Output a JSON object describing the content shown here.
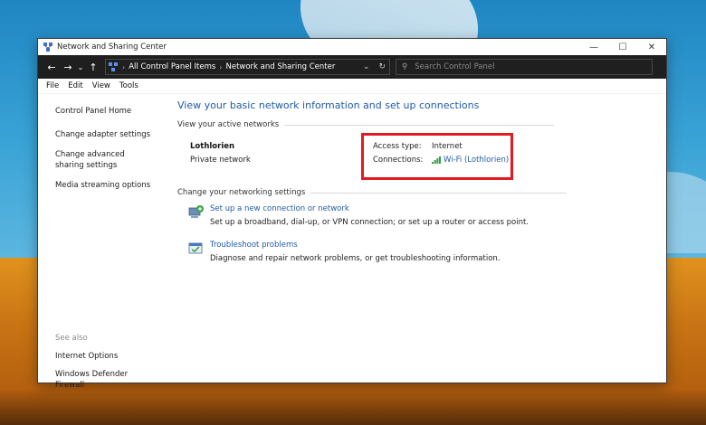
{
  "window": {
    "title": "Network and Sharing Center",
    "minimize_glyph": "—",
    "maximize_glyph": "☐",
    "close_glyph": "✕"
  },
  "address": {
    "back_glyph": "←",
    "forward_glyph": "→",
    "recent_glyph": "⌄",
    "up_glyph": "↑",
    "crumbs": [
      "All Control Panel Items",
      "Network and Sharing Center"
    ],
    "separator": "›",
    "dropdown_glyph": "⌄",
    "refresh_glyph": "↻",
    "search_placeholder": "Search Control Panel",
    "search_glyph": "⚲"
  },
  "menu": [
    "File",
    "Edit",
    "View",
    "Tools"
  ],
  "sidebar": {
    "home": "Control Panel Home",
    "links": [
      "Change adapter settings",
      "Change advanced sharing settings",
      "Media streaming options"
    ],
    "see_also_heading": "See also",
    "see_also": [
      "Internet Options",
      "Windows Defender Firewall"
    ]
  },
  "main": {
    "title": "View your basic network information and set up connections",
    "active_heading": "View your active networks",
    "network_name": "Lothlorien",
    "network_type": "Private network",
    "access_type_label": "Access type:",
    "access_type_value": "Internet",
    "connections_label": "Connections:",
    "connections_value": "Wi-Fi (Lothlorien)",
    "settings_heading": "Change your networking settings",
    "tasks": [
      {
        "title": "Set up a new connection or network",
        "desc": "Set up a broadband, dial-up, or VPN connection; or set up a router or access point."
      },
      {
        "title": "Troubleshoot problems",
        "desc": "Diagnose and repair network problems, or get troubleshooting information."
      }
    ]
  },
  "colors": {
    "link": "#1f5aa6",
    "highlight": "#e01b24",
    "addressbar": "#1f1f1f"
  }
}
